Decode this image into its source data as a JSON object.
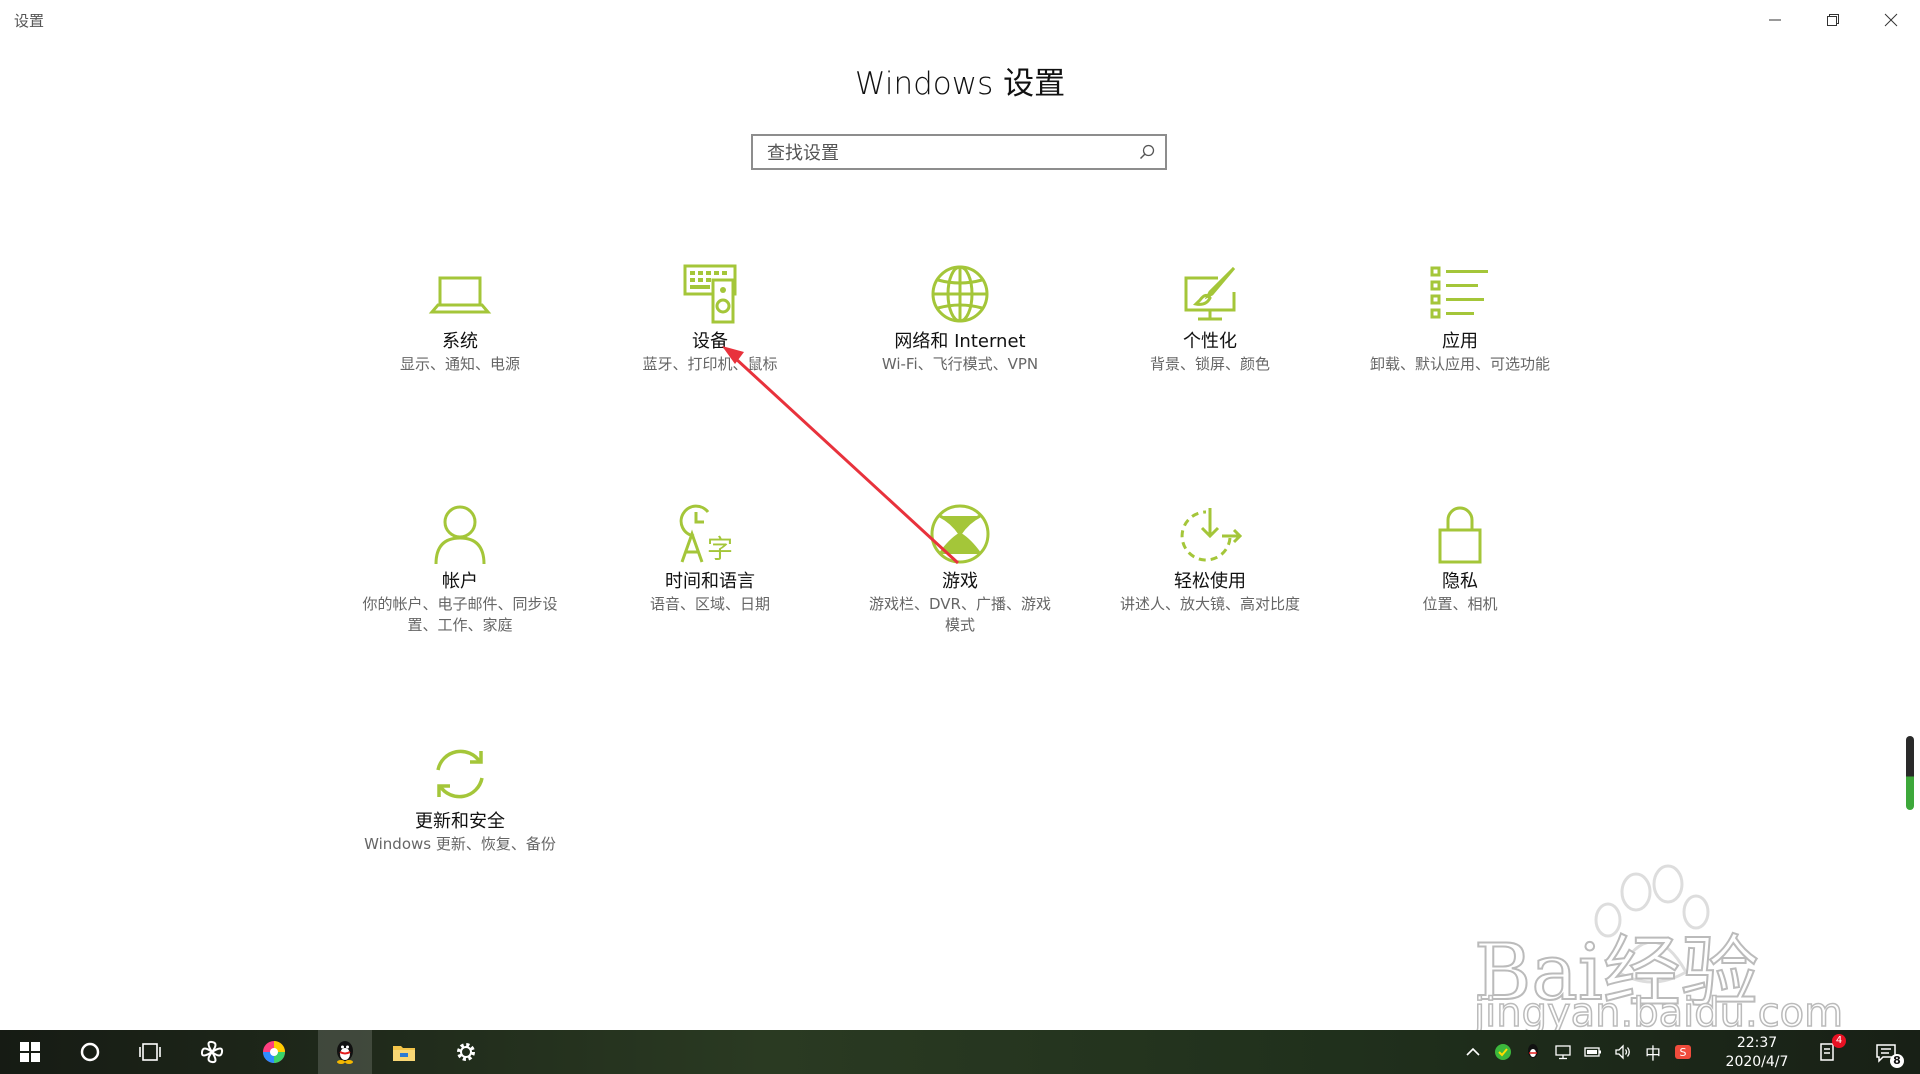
{
  "window": {
    "app_title": "设置",
    "minimize_icon": "minimize-icon",
    "maximize_icon": "restore-icon",
    "close_icon": "close-icon"
  },
  "page_title": "Windows 设置",
  "search": {
    "placeholder": "查找设置",
    "icon": "search-icon"
  },
  "accent_color": "#a4c639",
  "tiles": [
    {
      "id": "system",
      "icon": "laptop-icon",
      "label": "系统",
      "desc": "显示、通知、电源"
    },
    {
      "id": "devices",
      "icon": "keyboard-speaker-icon",
      "label": "设备",
      "desc": "蓝牙、打印机、鼠标"
    },
    {
      "id": "network",
      "icon": "globe-icon",
      "label": "网络和 Internet",
      "desc": "Wi-Fi、飞行模式、VPN"
    },
    {
      "id": "personalization",
      "icon": "paintbrush-monitor-icon",
      "label": "个性化",
      "desc": "背景、锁屏、颜色"
    },
    {
      "id": "apps",
      "icon": "list-icon",
      "label": "应用",
      "desc": "卸载、默认应用、可选功能"
    },
    {
      "id": "accounts",
      "icon": "person-icon",
      "label": "帐户",
      "desc": "你的帐户、电子邮件、同步设置、工作、家庭"
    },
    {
      "id": "time-language",
      "icon": "clock-language-icon",
      "label": "时间和语言",
      "desc": "语音、区域、日期"
    },
    {
      "id": "gaming",
      "icon": "xbox-icon",
      "label": "游戏",
      "desc": "游戏栏、DVR、广播、游戏模式"
    },
    {
      "id": "ease-of-access",
      "icon": "timer-icon",
      "label": "轻松使用",
      "desc": "讲述人、放大镜、高对比度"
    },
    {
      "id": "privacy",
      "icon": "lock-icon",
      "label": "隐私",
      "desc": "位置、相机"
    },
    {
      "id": "update-security",
      "icon": "refresh-icon",
      "label": "更新和安全",
      "desc": "Windows 更新、恢复、备份"
    }
  ],
  "annotation": {
    "color": "#e8323c"
  },
  "watermark": {
    "line1": "Bai经验",
    "line2": "jingyan.baidu.com"
  },
  "taskbar": {
    "items": [
      "windows-start-icon",
      "cortana-circle-icon",
      "task-view-icon",
      "pinwheel-icon",
      "browser-icon",
      "qq-penguin-icon",
      "file-explorer-icon",
      "settings-gear-icon"
    ],
    "tray": {
      "ime": "中",
      "time": "22:37",
      "date": "2020/4/7",
      "notification_badge": "4",
      "action_center_badge": "8"
    }
  }
}
